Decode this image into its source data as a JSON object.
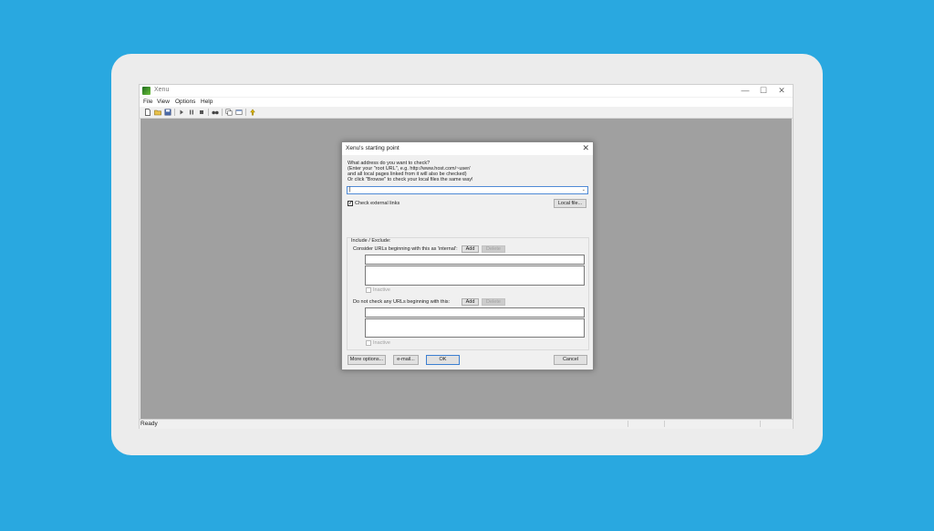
{
  "window": {
    "title": "Xenu",
    "controls": {
      "minimize": "—",
      "maximize": "☐",
      "close": "✕"
    }
  },
  "menu": [
    "File",
    "View",
    "Options",
    "Help"
  ],
  "toolbar": {
    "icons": [
      "new-file-icon",
      "open-folder-icon",
      "save-icon",
      "play-icon",
      "pause-icon",
      "stop-icon",
      "find-icon",
      "copy-icon",
      "properties-icon",
      "help-icon"
    ]
  },
  "status": {
    "text": "Ready"
  },
  "dialog": {
    "title": "Xenu's starting point",
    "close": "✕",
    "instructions": [
      "What address do you want to check?",
      "(Enter your \"root URL\", e.g. http://www.host.com/~user/",
      "and all local pages linked from it will also be checked)",
      "Or click \"Browse\" to check your local files the same way!"
    ],
    "address_value": "|",
    "address_arrow": "⌄",
    "check_external": {
      "label": "Check external links",
      "checked": true,
      "mark": "✓"
    },
    "local_file_button": "Local file...",
    "include_exclude": {
      "legend": "Include / Exclude:",
      "internal_label": "Consider URLs beginning with this as 'internal':",
      "add": "Add",
      "delete": "Delete",
      "inactive": "Inactive",
      "do_not_check_label": "Do not check any URLs beginning with this:"
    },
    "buttons": {
      "more_options": "More options...",
      "email": "e-mail...",
      "ok": "OK",
      "cancel": "Cancel"
    }
  },
  "colors": {
    "background": "#29a8e0",
    "frame": "#ececec",
    "client": "#a0a0a0",
    "accent": "#3c7fd1"
  }
}
